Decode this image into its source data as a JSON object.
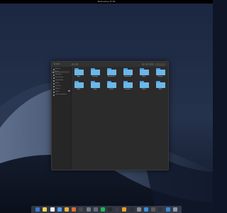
{
  "menubar": {
    "time": "Wednesday 15:06"
  },
  "window": {
    "sidebar": {
      "items": [
        {
          "label": "Recent",
          "selected": false
        },
        {
          "label": "Home",
          "selected": true
        },
        {
          "label": "Desktop",
          "selected": false
        },
        {
          "label": "Documents",
          "selected": false
        },
        {
          "label": "Downloads",
          "selected": false
        },
        {
          "label": "Music",
          "selected": false
        },
        {
          "label": "Pictures",
          "selected": false
        },
        {
          "label": "Videos",
          "selected": false
        },
        {
          "label": "Trash",
          "selected": false
        },
        {
          "label": "Other Locations",
          "selected": false
        }
      ]
    },
    "folders": [
      {
        "label": "Apps"
      },
      {
        "label": "Desktop"
      },
      {
        "label": "Documents"
      },
      {
        "label": "Downloads"
      },
      {
        "label": "Music"
      },
      {
        "label": "Pictures"
      },
      {
        "label": "Public"
      },
      {
        "label": "Snap"
      },
      {
        "label": "Steam"
      },
      {
        "label": "Templates"
      },
      {
        "label": "Videos"
      },
      {
        "label": "Work"
      }
    ]
  },
  "dock": {
    "apps": [
      {
        "name": "finder",
        "color": "#3b78d8"
      },
      {
        "name": "notes",
        "color": "#f3d44a"
      },
      {
        "name": "calendar",
        "color": "#f2f2f2"
      },
      {
        "name": "mail",
        "color": "#4e9be8"
      },
      {
        "name": "chrome",
        "color": "#e8b33a"
      },
      {
        "name": "firefox",
        "color": "#e36b2c"
      },
      {
        "name": "launcher",
        "color": "#4a4a4a"
      },
      {
        "name": "settings",
        "color": "#7a7a7a"
      },
      {
        "name": "tools",
        "color": "#5f6c7a"
      },
      {
        "name": "spotify",
        "color": "#1db954"
      },
      {
        "name": "terminal",
        "color": "#2a2a2a"
      },
      {
        "name": "games",
        "color": "#3c3c3c"
      },
      {
        "name": "store",
        "color": "#f2a01c"
      },
      {
        "name": "editor",
        "color": "#2d2d3a"
      },
      {
        "name": "sketch",
        "color": "#8a8a8a"
      },
      {
        "name": "network",
        "color": "#3b8ee0"
      },
      {
        "name": "monitor",
        "color": "#5a5a5a"
      },
      {
        "name": "media",
        "color": "#333333"
      },
      {
        "name": "files",
        "color": "#3a86d6"
      },
      {
        "name": "trash",
        "color": "#8a96a6"
      }
    ]
  }
}
